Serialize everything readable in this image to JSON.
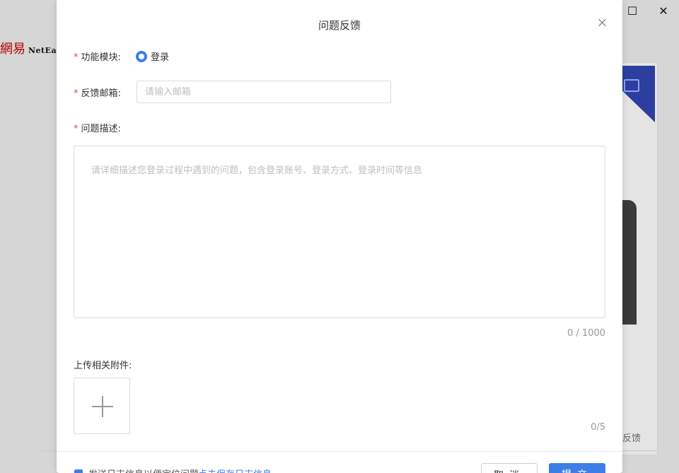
{
  "background": {
    "logo_cn": "網易",
    "logo_en": "NetEa",
    "side_text": "反馈",
    "window_controls": [
      "maximize-icon",
      "close-icon"
    ]
  },
  "dialog": {
    "title": "问题反馈",
    "required_mark": "*",
    "module": {
      "label": "功能模块:",
      "selected_option": "登录"
    },
    "email": {
      "label": "反馈邮箱:",
      "value": "",
      "placeholder": "请输入邮箱"
    },
    "description": {
      "label": "问题描述:",
      "value": "",
      "placeholder": "请详细描述您登录过程中遇到的问题，包含登录账号、登录方式、登录时间等信息",
      "counter": "0 / 1000"
    },
    "attachments": {
      "label": "上传相关附件:",
      "counter": "0/5"
    },
    "footer": {
      "checkbox_checked": true,
      "checkbox_label": "发送日志信息以便定位问题",
      "link_text": "点击保存日志信息",
      "cancel_label": "取消",
      "submit_label": "提交"
    }
  },
  "colors": {
    "accent": "#3d7ee8",
    "required": "#e04a3f",
    "placeholder": "#bfbfbf"
  }
}
